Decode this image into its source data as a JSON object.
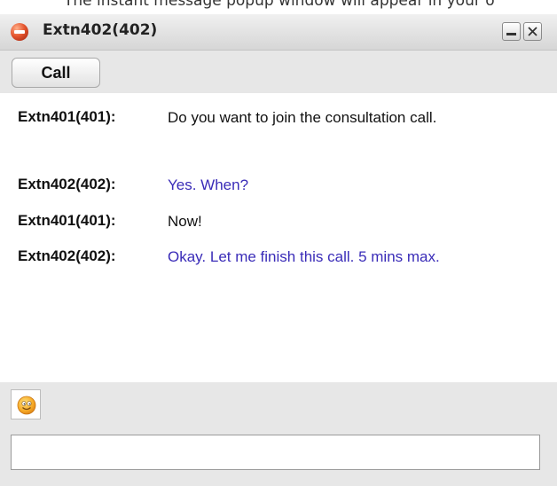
{
  "caption": "The instant message popup window will appear in your o",
  "window": {
    "title": "Extn402(402)",
    "buttons": {
      "minimize_icon": "minimize-icon",
      "close_icon": "close-icon"
    }
  },
  "toolbar": {
    "call_label": "Call"
  },
  "messages": [
    {
      "sender": "Extn401(401):",
      "text": "Do you want to join the consultation call.",
      "direction": "incoming"
    },
    {
      "sender": "Extn402(402):",
      "text": "Yes. When?",
      "direction": "outgoing"
    },
    {
      "sender": "Extn401(401):",
      "text": "Now!",
      "direction": "incoming"
    },
    {
      "sender": "Extn402(402):",
      "text": "Okay. Let me finish this call. 5 mins max.",
      "direction": "outgoing"
    }
  ],
  "composer": {
    "emoji_icon": "smiley-icon",
    "input_value": "",
    "input_placeholder": ""
  },
  "colors": {
    "outgoing_text": "#3a2cb8",
    "incoming_text": "#111111",
    "panel_background": "#e7e7e7",
    "status_icon": "#e4542d"
  }
}
